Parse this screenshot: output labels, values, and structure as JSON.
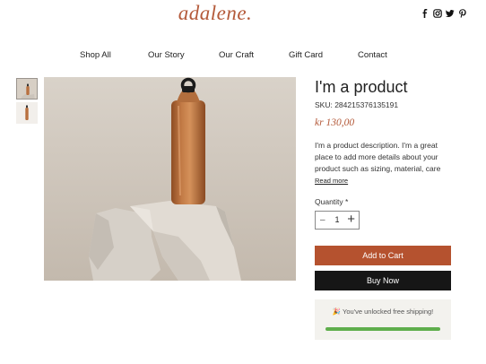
{
  "brand": {
    "logo": "adalene."
  },
  "social": [
    "facebook-icon",
    "instagram-icon",
    "twitter-icon",
    "pinterest-icon"
  ],
  "nav": {
    "items": [
      "Shop All",
      "Our Story",
      "Our Craft",
      "Gift Card",
      "Contact"
    ]
  },
  "product": {
    "title": "I'm a product",
    "sku": "SKU: 284215376135191",
    "price": "kr 130,00",
    "description": "I'm a product description. I'm a great place to add more details about your product such as sizing, material, care",
    "read_more": "Read more",
    "quantity_label": "Quantity *",
    "quantity_value": "1",
    "add_to_cart": "Add to Cart",
    "buy_now": "Buy Now"
  },
  "shipping": {
    "message": "🎉 You've unlocked free shipping!",
    "progress": 1.0
  },
  "colors": {
    "accent": "#b5522f",
    "bottle": "#b8703f",
    "progress": "#5fae4c",
    "dark_button": "#161616"
  }
}
